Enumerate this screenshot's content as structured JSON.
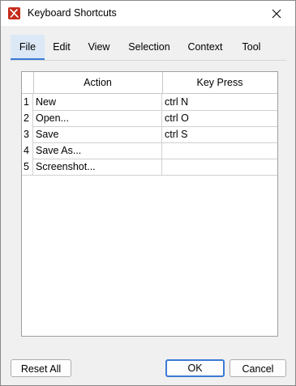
{
  "window": {
    "title": "Keyboard Shortcuts",
    "accent": "#3a7bd5",
    "icon_color": "#c42b1c"
  },
  "tabs": [
    {
      "label": "File",
      "active": true
    },
    {
      "label": "Edit",
      "active": false
    },
    {
      "label": "View",
      "active": false
    },
    {
      "label": "Selection",
      "active": false
    },
    {
      "label": "Context",
      "active": false
    },
    {
      "label": "Tool",
      "active": false
    }
  ],
  "table": {
    "columns": [
      "Action",
      "Key Press"
    ],
    "rows": [
      {
        "num": "1",
        "action": "New",
        "key": "ctrl N"
      },
      {
        "num": "2",
        "action": "Open...",
        "key": "ctrl O"
      },
      {
        "num": "3",
        "action": "Save",
        "key": "ctrl S"
      },
      {
        "num": "4",
        "action": "Save As...",
        "key": ""
      },
      {
        "num": "5",
        "action": "Screenshot...",
        "key": ""
      }
    ]
  },
  "buttons": {
    "reset_all": "Reset All",
    "ok": "OK",
    "cancel": "Cancel"
  }
}
